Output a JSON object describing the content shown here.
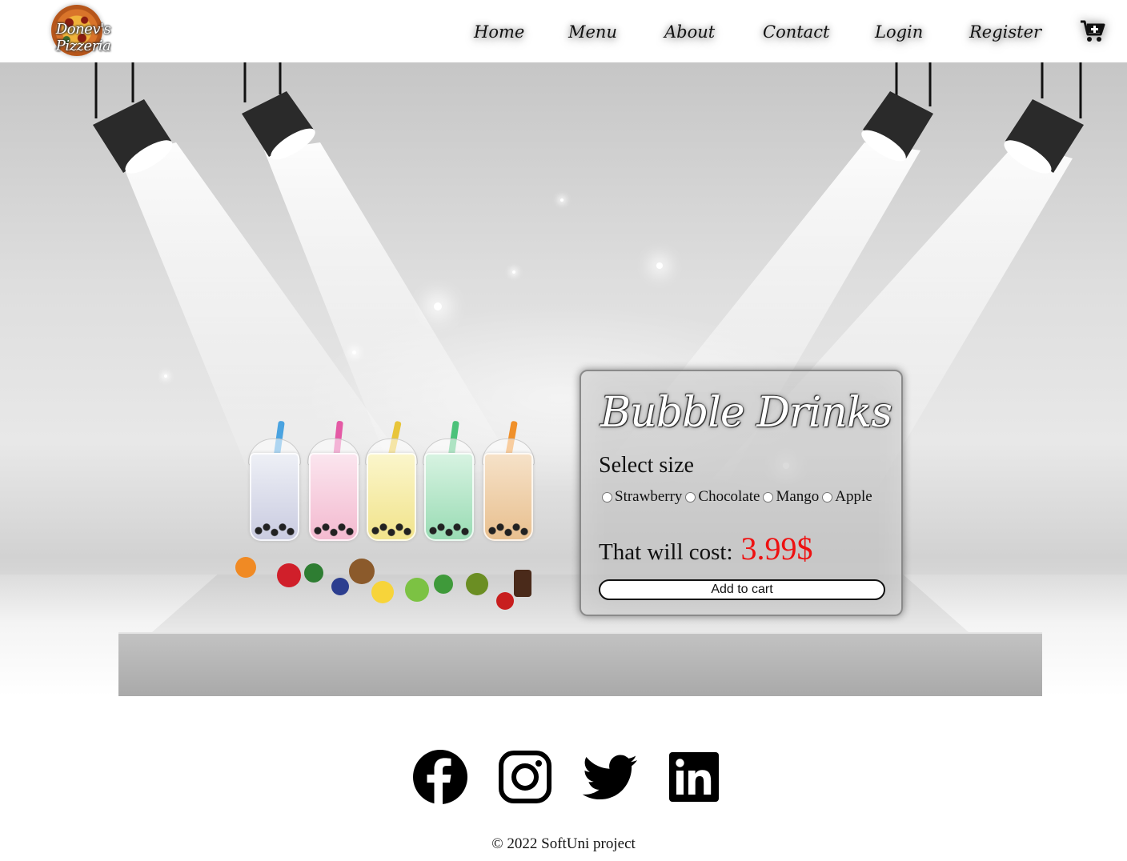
{
  "header": {
    "logo_text": "Donev's Pizzeria",
    "nav": [
      "Home",
      "Menu",
      "About",
      "Contact",
      "Login",
      "Register"
    ],
    "cart_icon": "cart-plus-icon"
  },
  "product": {
    "title": "Bubble Drinks",
    "select_label": "Select size",
    "options": [
      "Strawberry",
      "Chocolate",
      "Mango",
      "Apple"
    ],
    "price_label": "That will cost:",
    "price": "3.99$",
    "add_to_cart": "Add to cart"
  },
  "footer": {
    "social_icons": [
      "facebook-icon",
      "instagram-icon",
      "twitter-icon",
      "linkedin-icon"
    ],
    "copyright": "© 2022 SoftUni project"
  },
  "colors": {
    "price": "#ee1111",
    "text": "#111111",
    "background": "#ffffff"
  }
}
